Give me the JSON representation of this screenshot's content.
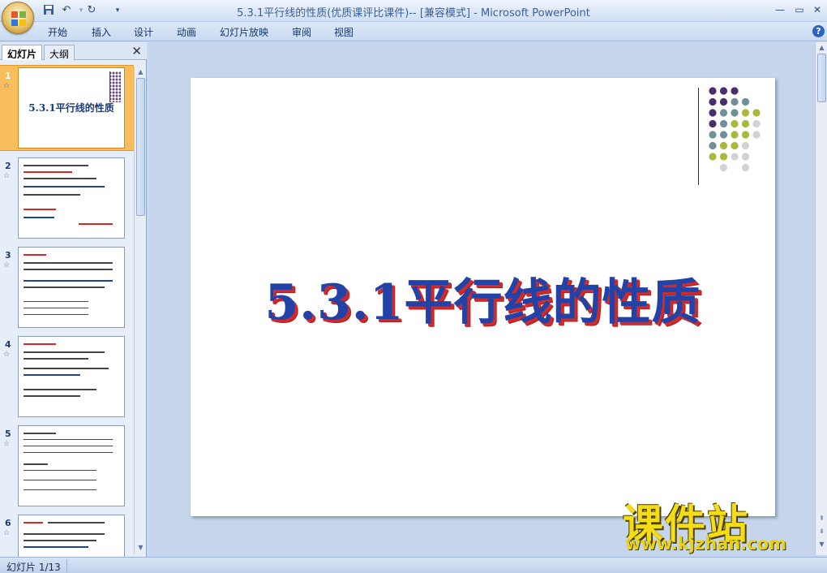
{
  "window": {
    "title": "5.3.1平行线的性质(优质课评比课件)-- [兼容模式] - Microsoft PowerPoint",
    "controls": [
      "minimize",
      "maximize",
      "close"
    ]
  },
  "quick_access": [
    {
      "name": "save-icon",
      "glyph": "■"
    },
    {
      "name": "undo-icon",
      "glyph": "↶"
    },
    {
      "name": "redo-icon",
      "glyph": "↻"
    },
    {
      "name": "customize-icon",
      "glyph": "▾"
    }
  ],
  "ribbon": {
    "tabs": [
      "开始",
      "插入",
      "设计",
      "动画",
      "幻灯片放映",
      "审阅",
      "视图"
    ],
    "help": "?"
  },
  "left_pane": {
    "tabs": {
      "slides": "幻灯片",
      "outline": "大纲"
    },
    "close": "✕",
    "slides": [
      {
        "num": "1",
        "anim": "☆",
        "title": "5.3.1平行线的性质",
        "selected": true
      },
      {
        "num": "2",
        "anim": "☆"
      },
      {
        "num": "3",
        "anim": "☆"
      },
      {
        "num": "4",
        "anim": "☆"
      },
      {
        "num": "5",
        "anim": "☆"
      },
      {
        "num": "6",
        "anim": "☆"
      }
    ]
  },
  "slide": {
    "title": "5.3.1平行线的性质",
    "dot_colors": {
      "purple": "#4a2d6a",
      "teal": "#6f8f9b",
      "olive": "#a9b83a",
      "gray": "#cfd3d8"
    }
  },
  "watermark": {
    "main": "课件站",
    "url": "www.kjzhan.com"
  },
  "status": {
    "text": "幻灯片 1/13"
  }
}
